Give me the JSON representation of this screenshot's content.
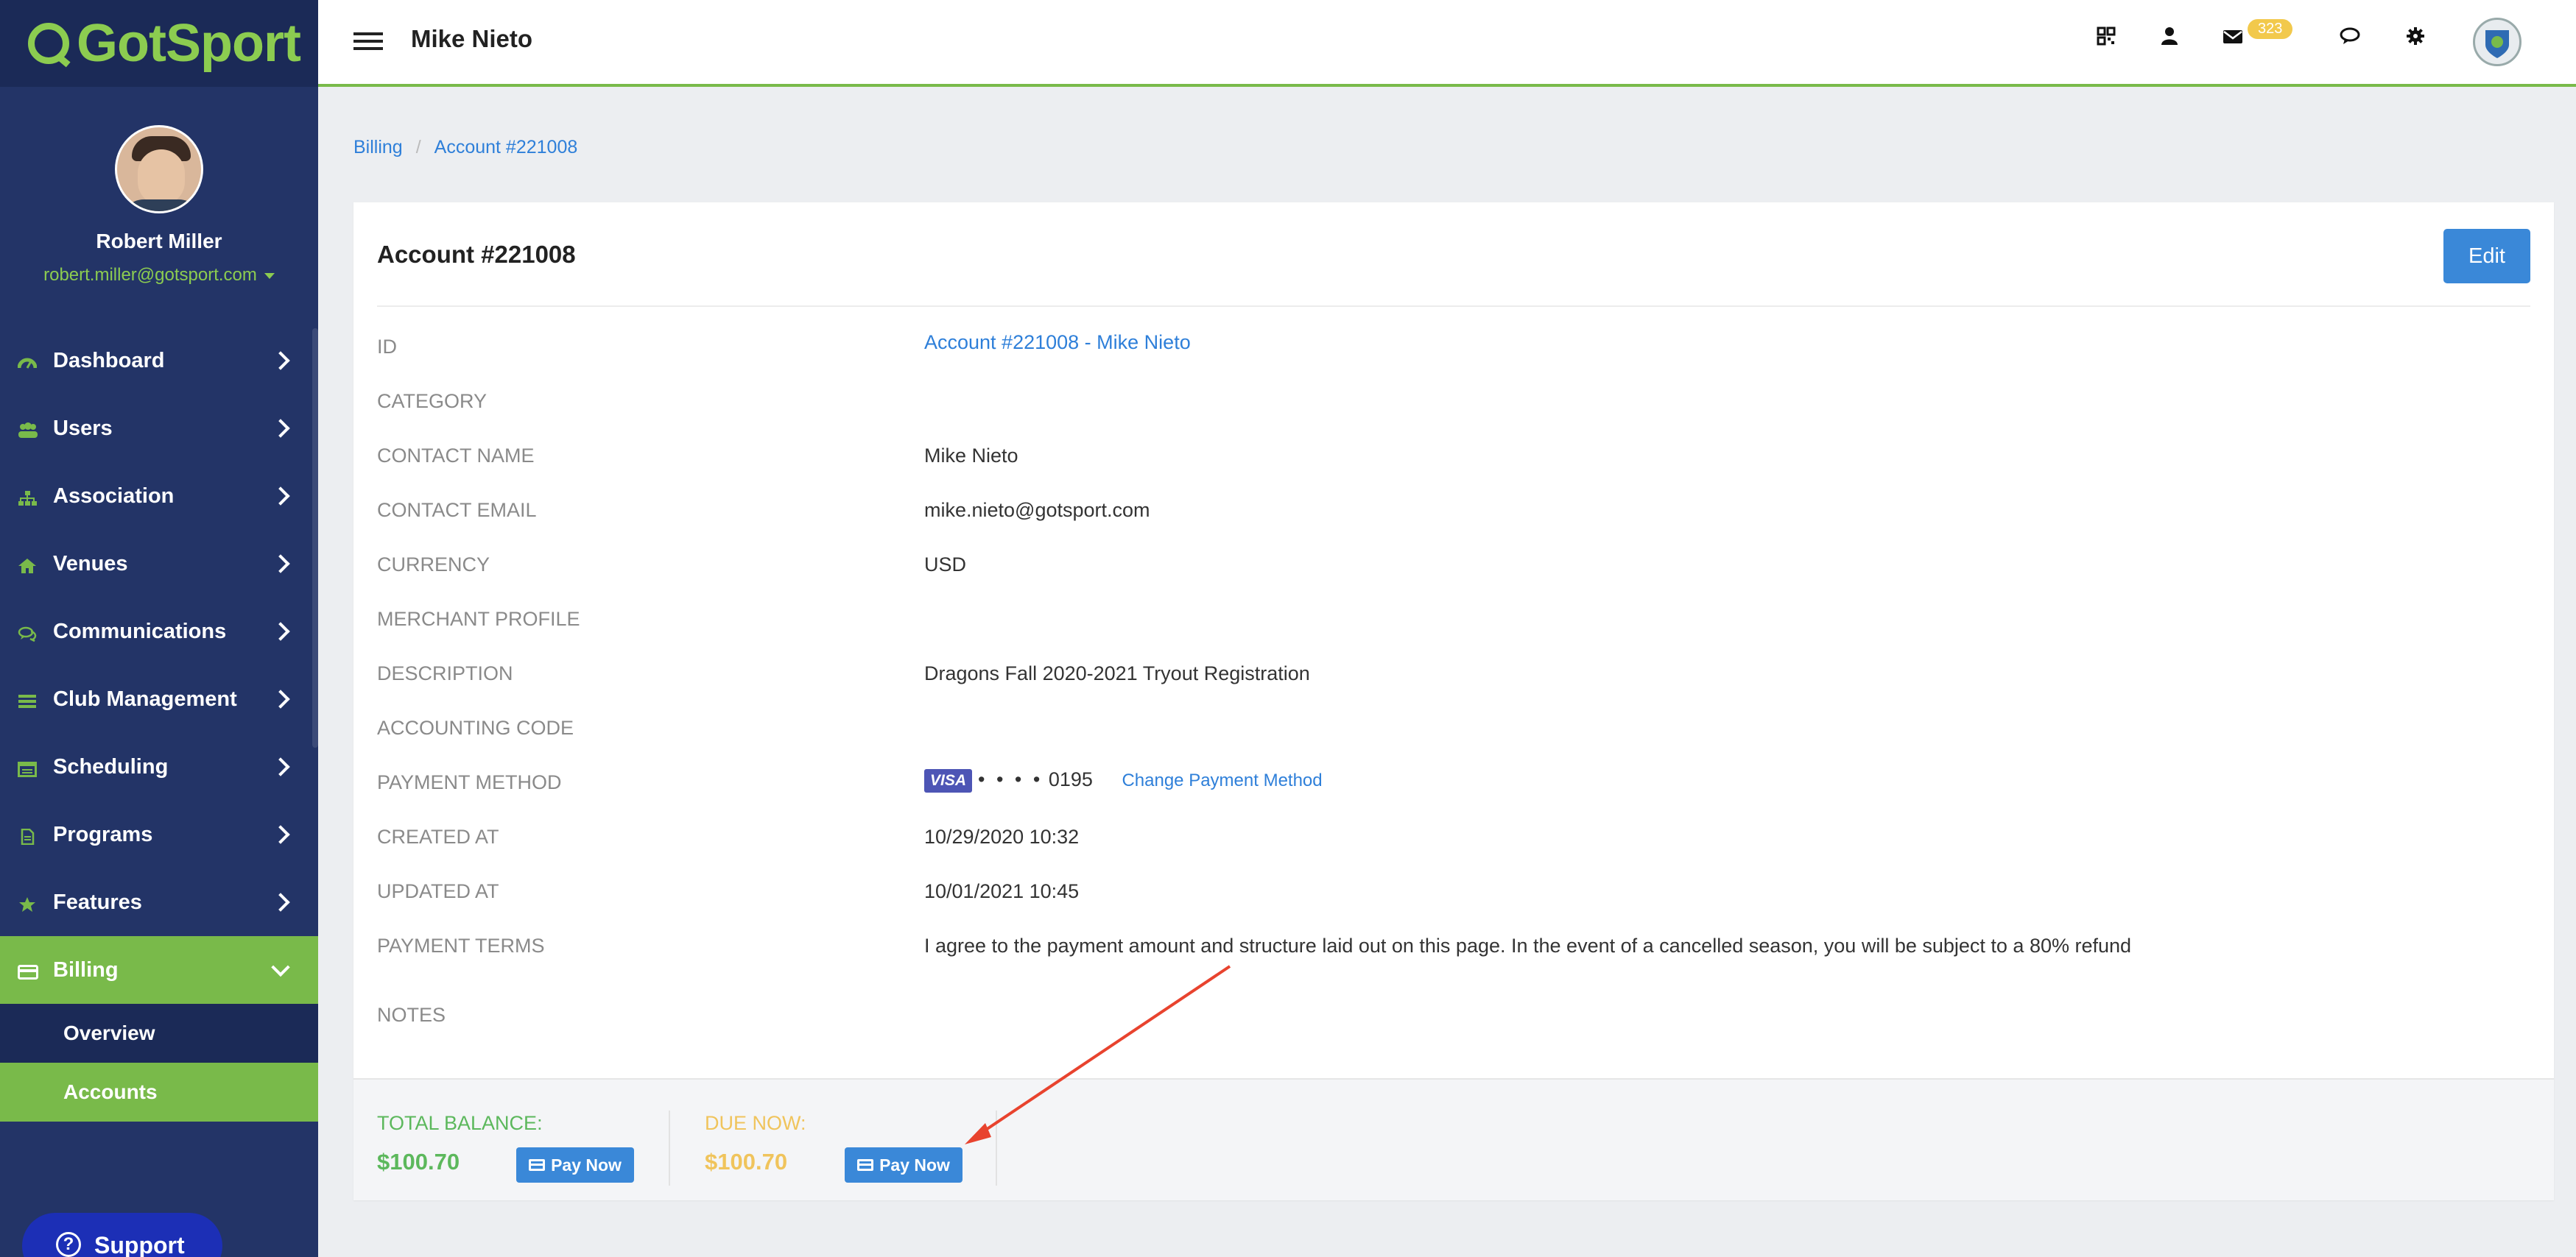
{
  "app": {
    "brand": "GotSport"
  },
  "profile": {
    "name": "Robert Miller",
    "email": "robert.miller@gotsport.com"
  },
  "sidebar": {
    "items": [
      {
        "label": "Dashboard",
        "icon": "dashboard-icon"
      },
      {
        "label": "Users",
        "icon": "users-icon"
      },
      {
        "label": "Association",
        "icon": "sitemap-icon"
      },
      {
        "label": "Venues",
        "icon": "home-icon"
      },
      {
        "label": "Communications",
        "icon": "chat-icon"
      },
      {
        "label": "Club Management",
        "icon": "list-icon"
      },
      {
        "label": "Scheduling",
        "icon": "calendar-icon"
      },
      {
        "label": "Programs",
        "icon": "document-icon"
      },
      {
        "label": "Features",
        "icon": "star-icon"
      },
      {
        "label": "Billing",
        "icon": "credit-card-icon"
      }
    ],
    "billing_sub": [
      {
        "label": "Overview"
      },
      {
        "label": "Accounts"
      }
    ],
    "support_label": "Support"
  },
  "topbar": {
    "title": "Mike Nieto",
    "badge_count": "323"
  },
  "breadcrumb": {
    "root": "Billing",
    "current": "Account #221008"
  },
  "account": {
    "title": "Account #221008",
    "edit_label": "Edit",
    "rows": [
      {
        "label": "ID",
        "value": "Account #221008 - Mike Nieto"
      },
      {
        "label": "CATEGORY",
        "value": ""
      },
      {
        "label": "CONTACT NAME",
        "value": "Mike Nieto"
      },
      {
        "label": "CONTACT EMAIL",
        "value": "mike.nieto@gotsport.com"
      },
      {
        "label": "CURRENCY",
        "value": "USD"
      },
      {
        "label": "MERCHANT PROFILE",
        "value": ""
      },
      {
        "label": "DESCRIPTION",
        "value": "Dragons Fall 2020-2021 Tryout Registration"
      },
      {
        "label": "ACCOUNTING CODE",
        "value": ""
      },
      {
        "label": "PAYMENT METHOD",
        "value": ""
      },
      {
        "label": "CREATED AT",
        "value": "10/29/2020 10:32"
      },
      {
        "label": "UPDATED AT",
        "value": "10/01/2021 10:45"
      },
      {
        "label": "PAYMENT TERMS",
        "value": "I agree to the payment amount and structure laid out on this page. In the event of a cancelled season, you will be subject to a 80% refund"
      },
      {
        "label": "NOTES",
        "value": ""
      }
    ],
    "payment_method": {
      "brand": "VISA",
      "masked": "• • • •",
      "last4": "0195",
      "change_label": "Change Payment Method"
    }
  },
  "balance": {
    "total_label": "TOTAL BALANCE:",
    "total_amount": "$100.70",
    "due_label": "DUE NOW:",
    "due_amount": "$100.70",
    "pay_label": "Pay Now"
  },
  "colors": {
    "sidebar": "#233467",
    "accent_green": "#79ba4a",
    "link_blue": "#2e7fd9",
    "button_blue": "#3a88d8",
    "amber": "#f0c45c",
    "annotation_red": "#e8432e"
  }
}
